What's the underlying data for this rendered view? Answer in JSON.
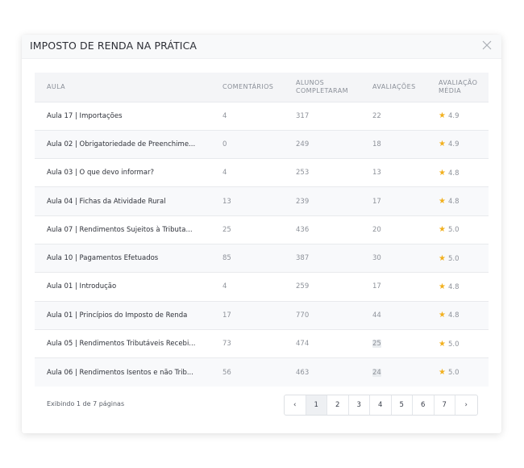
{
  "modal": {
    "title": "IMPOSTO DE RENDA NA PRÁTICA",
    "close_icon": "close-icon"
  },
  "table": {
    "headers": [
      "AULA",
      "COMENTÁRIOS",
      "ALUNOS COMPLETARAM",
      "AVALIAÇÕES",
      "AVALIAÇÃO MÉDIA"
    ],
    "rows": [
      {
        "aula": "Aula 17 | Importações",
        "comentarios": "4",
        "alunos": "317",
        "avaliacoes": "22",
        "media": "4.9"
      },
      {
        "aula": "Aula 02 | Obrigatoriedade de Preenchime...",
        "comentarios": "0",
        "alunos": "249",
        "avaliacoes": "18",
        "media": "4.9"
      },
      {
        "aula": "Aula 03 | O que devo informar?",
        "comentarios": "4",
        "alunos": "253",
        "avaliacoes": "13",
        "media": "4.8"
      },
      {
        "aula": "Aula 04 | Fichas da Atividade Rural",
        "comentarios": "13",
        "alunos": "239",
        "avaliacoes": "17",
        "media": "4.8"
      },
      {
        "aula": "Aula 07 | Rendimentos Sujeitos à Tributa...",
        "comentarios": "25",
        "alunos": "436",
        "avaliacoes": "20",
        "media": "5.0"
      },
      {
        "aula": "Aula 10 | Pagamentos Efetuados",
        "comentarios": "85",
        "alunos": "387",
        "avaliacoes": "30",
        "media": "5.0"
      },
      {
        "aula": "Aula 01 | Introdução",
        "comentarios": "4",
        "alunos": "259",
        "avaliacoes": "17",
        "media": "4.8"
      },
      {
        "aula": "Aula 01 | Princípios do Imposto de Renda",
        "comentarios": "17",
        "alunos": "770",
        "avaliacoes": "44",
        "media": "4.8"
      },
      {
        "aula": "Aula 05 | Rendimentos Tributáveis Recebi...",
        "comentarios": "73",
        "alunos": "474",
        "avaliacoes": "25",
        "media": "5.0"
      },
      {
        "aula": "Aula 06 | Rendimentos Isentos e não Trib...",
        "comentarios": "56",
        "alunos": "463",
        "avaliacoes": "24",
        "media": "5.0"
      }
    ],
    "star_icon": "star-icon"
  },
  "footer": {
    "page_info": "Exibindo 1 de 7 páginas",
    "pages": [
      "1",
      "2",
      "3",
      "4",
      "5",
      "6",
      "7"
    ],
    "current_page": "1",
    "prev_label": "‹",
    "next_label": "›"
  },
  "colors": {
    "star": "#f2b01e",
    "header_bg": "#f4f5f7",
    "striped_row": "#f8f9fb"
  }
}
